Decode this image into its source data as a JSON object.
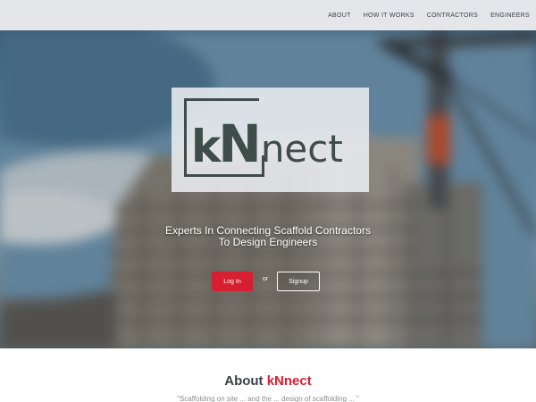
{
  "nav": {
    "items": [
      {
        "label": "ABOUT"
      },
      {
        "label": "HOW IT WORKS"
      },
      {
        "label": "CONTRACTORS"
      },
      {
        "label": "ENGINEERS"
      }
    ]
  },
  "hero": {
    "logo": {
      "k": "k",
      "n": "N",
      "rest": "nect"
    },
    "tagline_line1": "Experts In Connecting Scaffold Contractors",
    "tagline_line2": "To Design Engineers",
    "login_label": "Log In",
    "or_label": "or",
    "signup_label": "Signup"
  },
  "about": {
    "heading_prefix": "About ",
    "heading_brand": "kNnect",
    "snippet": "\"Scaffolding on site ... and the ... design of scaffolding ... \""
  },
  "colors": {
    "accent": "#d81e31",
    "nav_bg": "#e4e6ea",
    "logo_ink": "#3e4d48",
    "text": "#3c4047"
  }
}
